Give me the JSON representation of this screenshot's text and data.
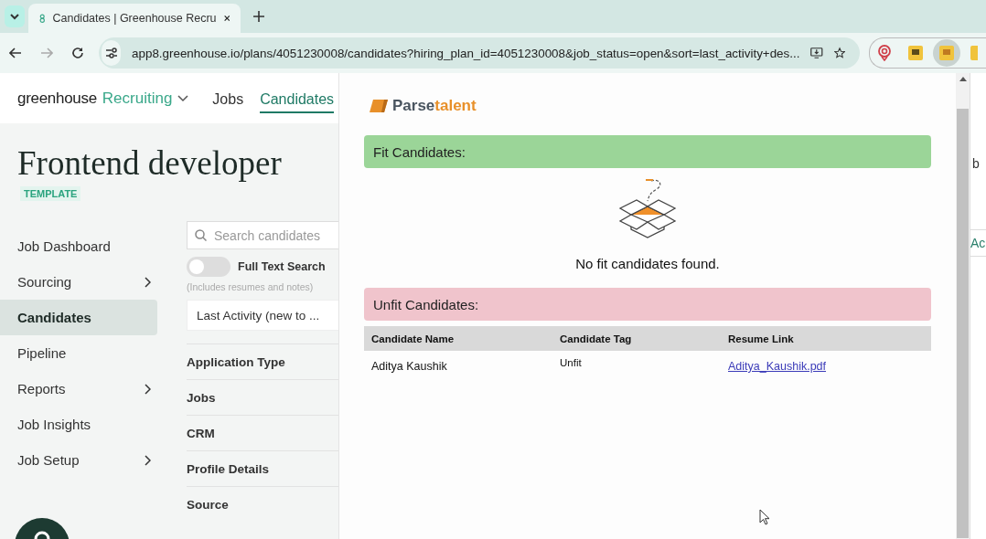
{
  "browser": {
    "tabs": [
      {
        "title": "Candidates | Greenhouse Recru",
        "selected": true
      }
    ],
    "url": "app8.greenhouse.io/plans/4051230008/candidates?hiring_plan_id=4051230008&job_status=open&sort=last_activity+des..."
  },
  "app": {
    "brand": "greenhouse",
    "product": "Recruiting",
    "nav": [
      {
        "label": "Jobs",
        "selected": false
      },
      {
        "label": "Candidates",
        "selected": true
      }
    ],
    "job_title": "Frontend developer",
    "badge": "TEMPLATE",
    "sidebar": {
      "items": [
        {
          "label": "Job Dashboard",
          "selected": false,
          "expandable": false
        },
        {
          "label": "Sourcing",
          "selected": false,
          "expandable": true
        },
        {
          "label": "Candidates",
          "selected": true,
          "expandable": false
        },
        {
          "label": "Pipeline",
          "selected": false,
          "expandable": false
        },
        {
          "label": "Reports",
          "selected": false,
          "expandable": true
        },
        {
          "label": "Job Insights",
          "selected": false,
          "expandable": false
        },
        {
          "label": "Job Setup",
          "selected": false,
          "expandable": true
        }
      ]
    },
    "filters": {
      "search": {
        "placeholder": "Search candidates"
      },
      "full_text_search": {
        "label": "Full Text Search",
        "on": false,
        "hint": "(Includes resumes and notes)"
      },
      "sort": "Last Activity (new to ...",
      "sections": [
        "Application Type",
        "Jobs",
        "CRM",
        "Profile Details",
        "Source"
      ]
    }
  },
  "panel": {
    "logo": {
      "first": "Parse",
      "second": "talent"
    },
    "fit": {
      "title": "Fit Candidates:",
      "empty_message": "No fit candidates found."
    },
    "unfit": {
      "title": "Unfit Candidates:",
      "table": {
        "columns": [
          "Candidate Name",
          "Candidate Tag",
          "Resume Link"
        ],
        "rows": [
          {
            "name": "Aditya Kaushik",
            "tag": "Unfit",
            "resume": "Aditya_Kaushik.pdf"
          }
        ]
      }
    }
  },
  "background_page": {
    "texts": [
      "b",
      "Ac"
    ]
  }
}
